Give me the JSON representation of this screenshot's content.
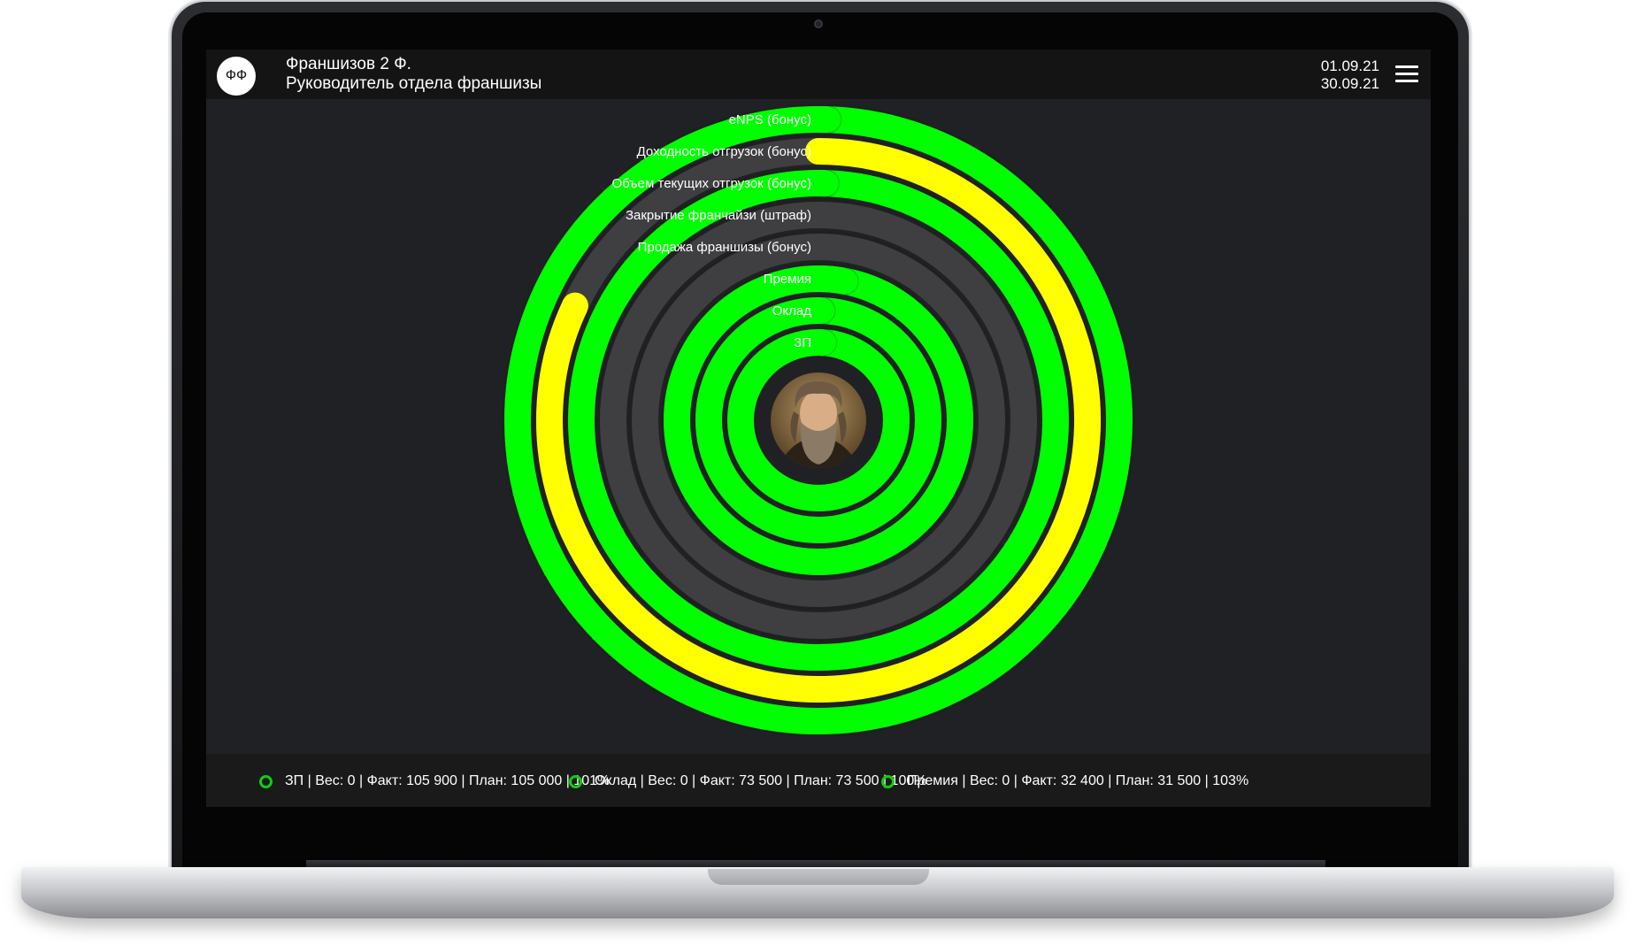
{
  "header": {
    "initials": "ФФ",
    "user_name": "Франшизов 2 Ф.",
    "user_role": "Руководитель отдела франшизы",
    "date_from": "01.09.21",
    "date_to": "30.09.21"
  },
  "colors": {
    "green": "#00ff00",
    "yellow": "#ffff00",
    "track": "#3f3f41",
    "background": "#202124",
    "legend_dot": "#12cc12"
  },
  "rings": [
    {
      "label": "ЗП",
      "progress": 1.01,
      "color": "green"
    },
    {
      "label": "Оклад",
      "progress": 1.0,
      "color": "green"
    },
    {
      "label": "Премия",
      "progress": 1.03,
      "color": "green"
    },
    {
      "label": "Продажа франшизы (бонус)",
      "progress": 0,
      "color": "green"
    },
    {
      "label": "Закрытие франчайзи (штраф)",
      "progress": 0,
      "color": "green"
    },
    {
      "label": "Объем текущих отгрузок  (бонус)",
      "progress": 1.0,
      "color": "green"
    },
    {
      "label": "Доходность отгрузок (бонус)",
      "progress": 0.82,
      "color": "yellow"
    },
    {
      "label": "eNPS (бонус)",
      "progress": 1.0,
      "color": "green"
    }
  ],
  "legend": [
    {
      "text": "ЗП | Вес: 0 | Факт: 105 900 | План: 105 000 | 101%"
    },
    {
      "text": "Оклад | Вес: 0 | Факт: 73 500 | План: 73 500 | 100%"
    },
    {
      "text": "Премия | Вес: 0 | Факт: 32 400 | План: 31 500 | 103%"
    }
  ]
}
